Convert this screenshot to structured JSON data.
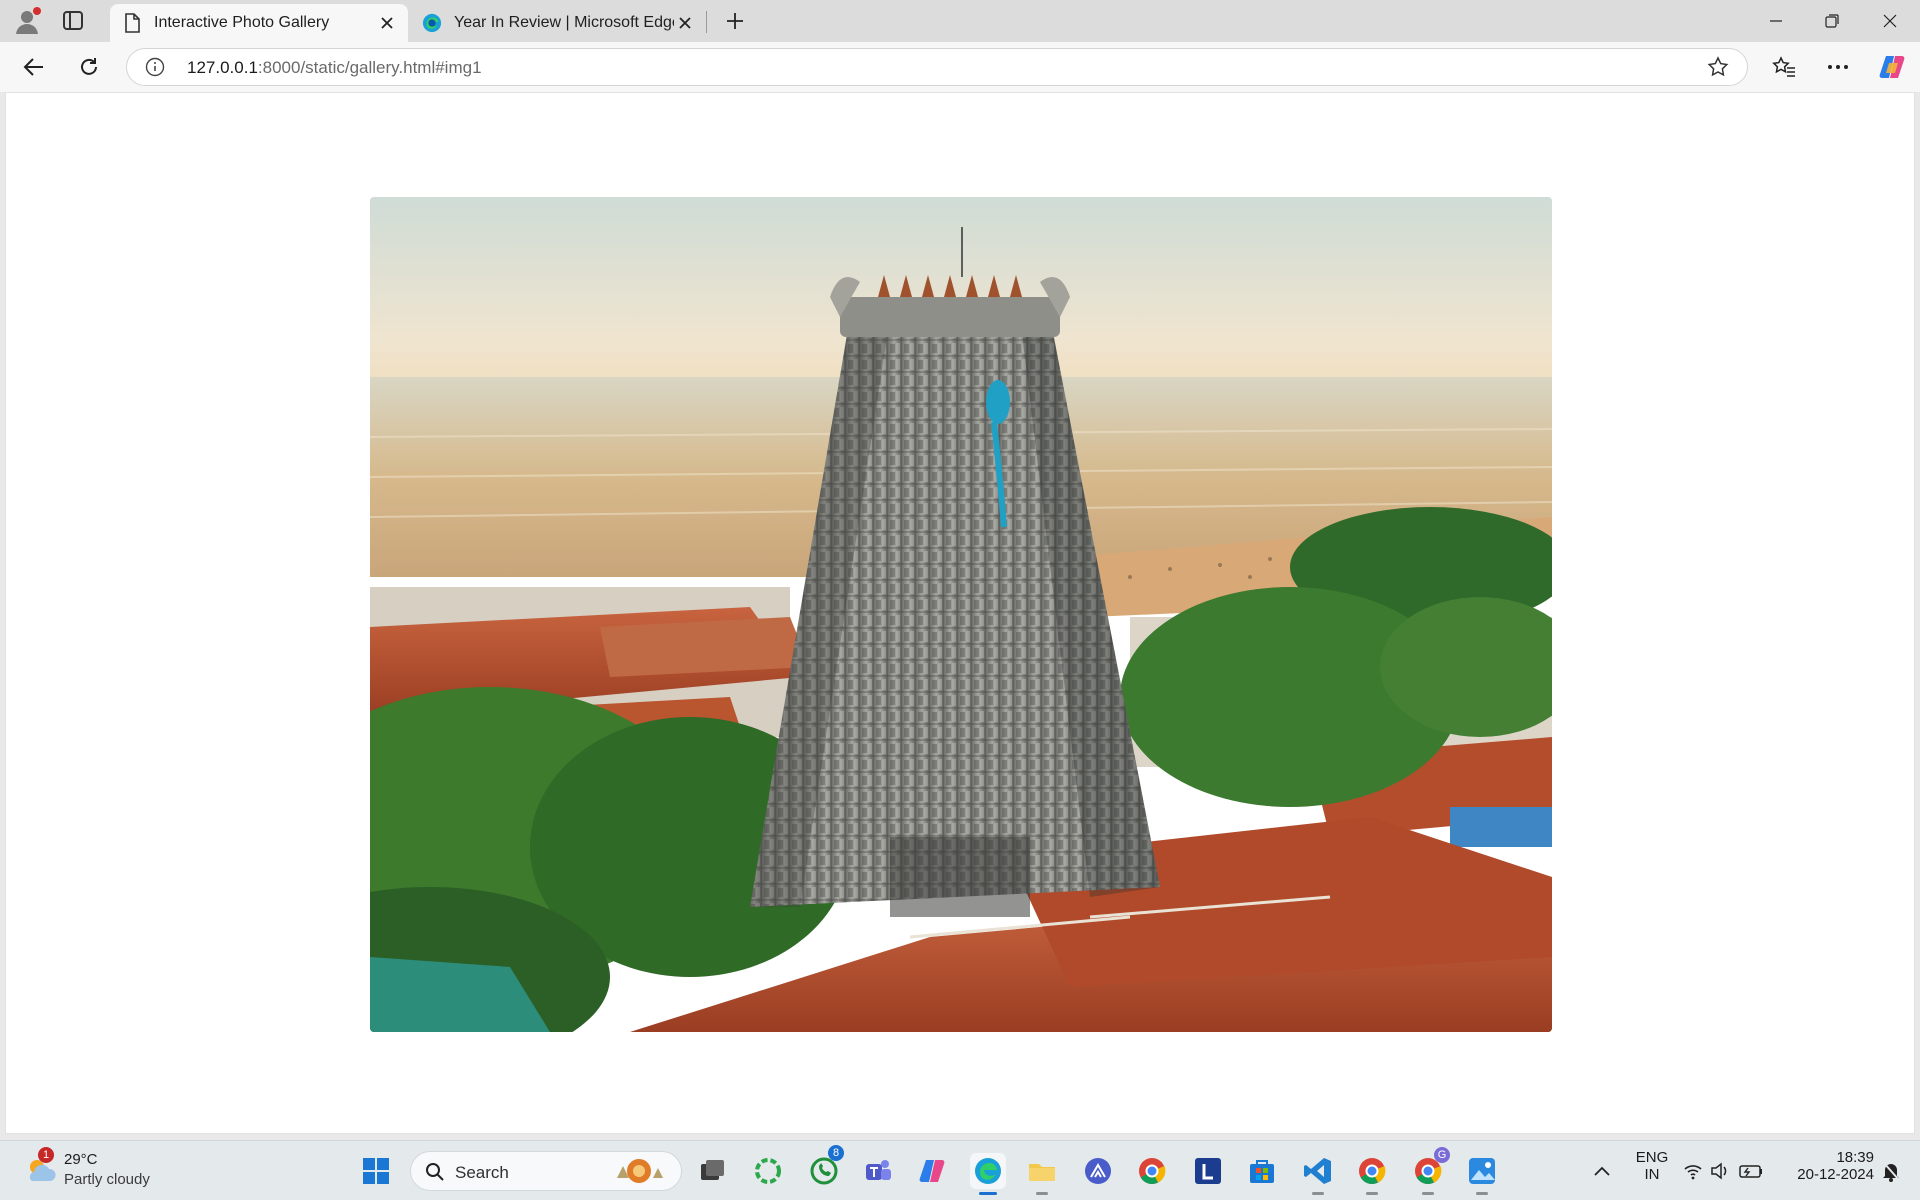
{
  "browser": {
    "tabs": [
      {
        "title": "Interactive Photo Gallery",
        "active": true
      },
      {
        "title": "Year In Review | Microsoft Edge",
        "active": false
      }
    ],
    "address": {
      "host": "127.0.0.1",
      "path": ":8000/static/gallery.html#img1"
    }
  },
  "page": {
    "image": {
      "alt": "Temple gopuram tower beside the sea at sunrise",
      "icon": "photo-image"
    }
  },
  "taskbar": {
    "weather": {
      "temp": "29°C",
      "condition": "Partly cloudy",
      "badge": "1"
    },
    "search_label": "Search",
    "whatsapp_badge": "8",
    "chrome_profile_badge": "G",
    "language": {
      "line1": "ENG",
      "line2": "IN"
    },
    "clock": {
      "time": "18:39",
      "date": "20-12-2024"
    }
  },
  "colors": {
    "accent": "#1a6fd1",
    "edge_tab_bg": "#f7f7f7"
  }
}
